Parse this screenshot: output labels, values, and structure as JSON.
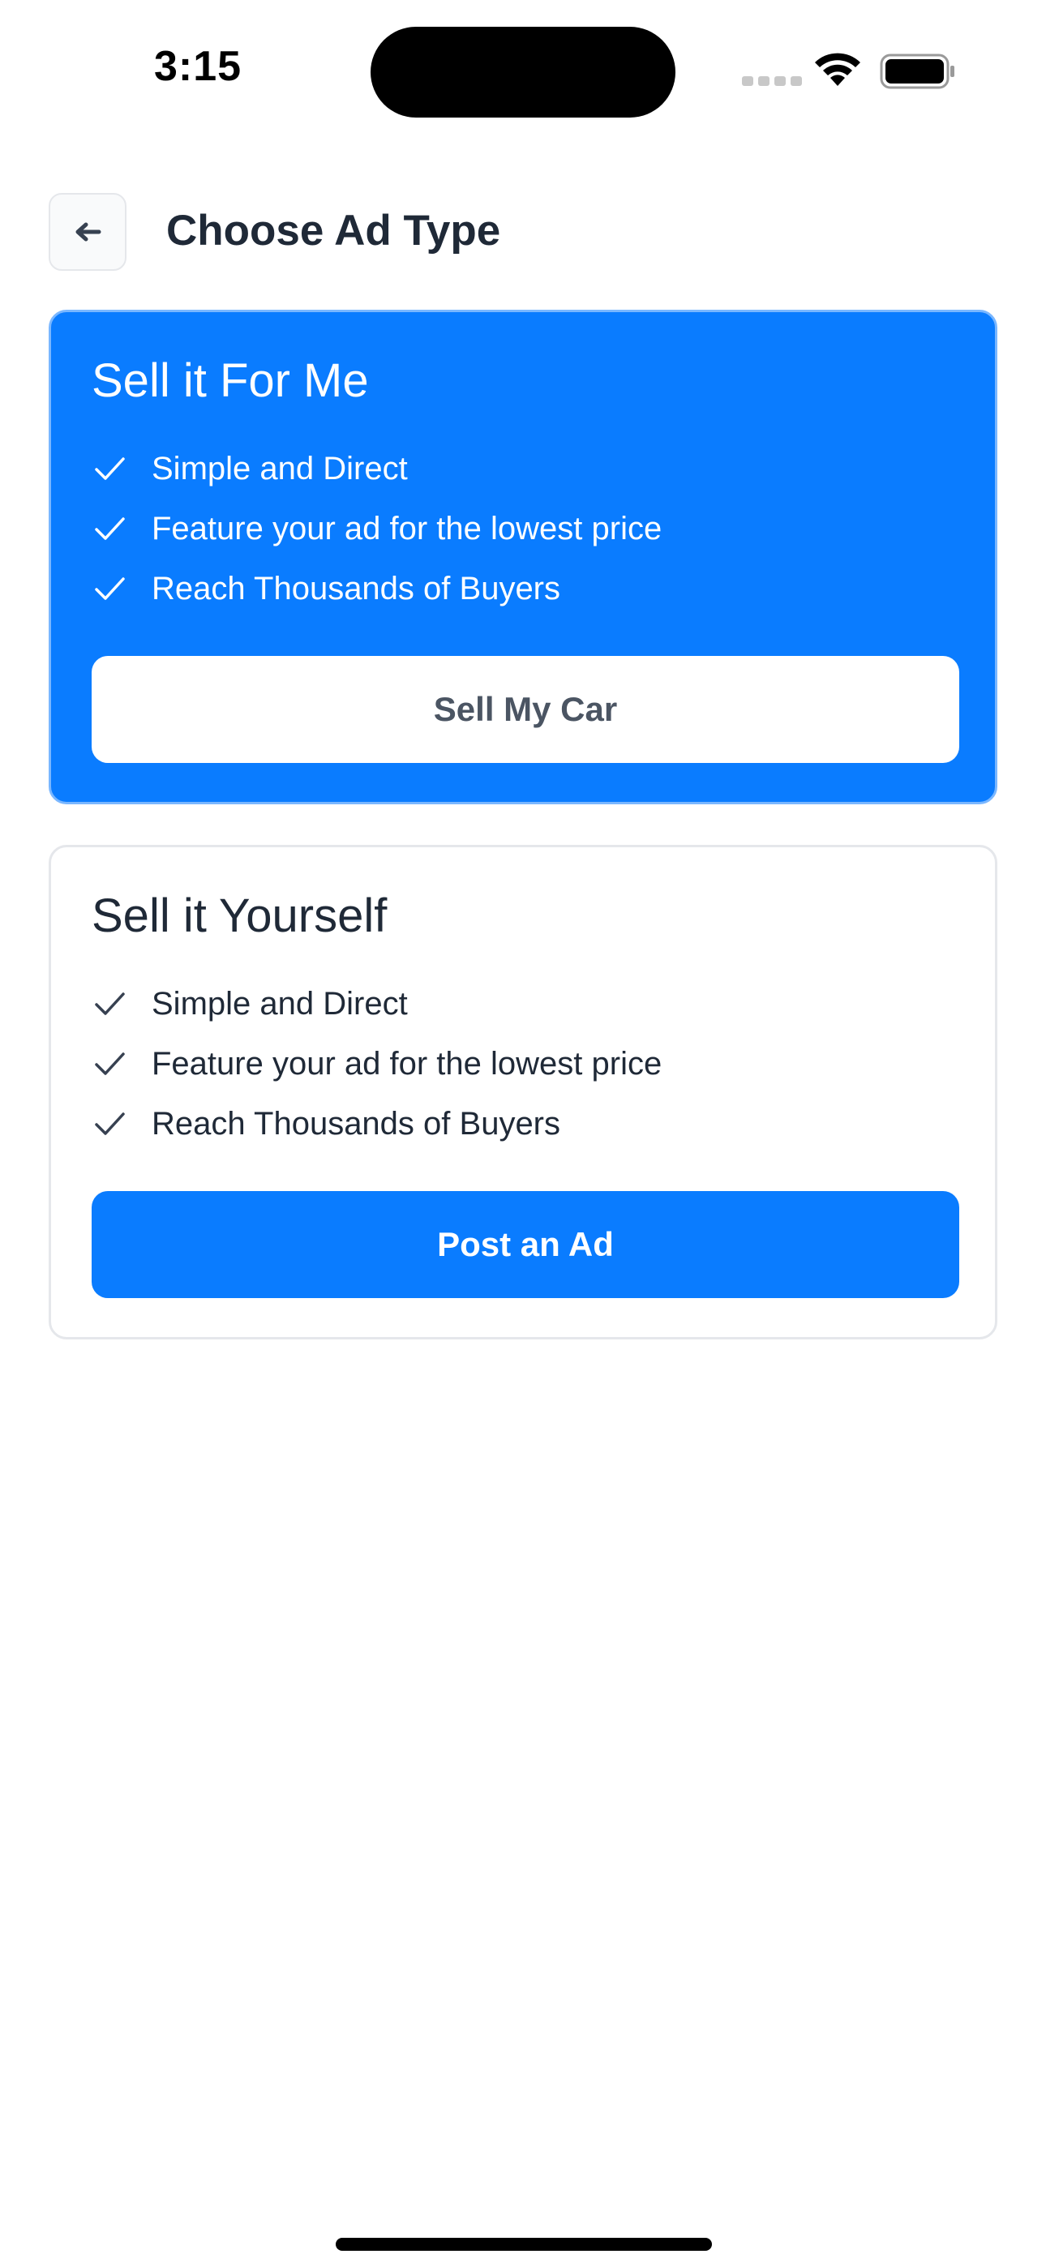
{
  "status_bar": {
    "time": "3:15",
    "icons": [
      "cellular-signal-icon",
      "wifi-icon",
      "battery-icon"
    ]
  },
  "header": {
    "back_icon": "arrow-left-icon",
    "title": "Choose Ad Type"
  },
  "cards": [
    {
      "title": "Sell it For Me",
      "features": [
        "Simple and Direct",
        "Feature your ad for the lowest price",
        "Reach Thousands of Buyers"
      ],
      "button_label": "Sell My Car",
      "style": "primary"
    },
    {
      "title": "Sell it Yourself",
      "features": [
        "Simple and Direct",
        "Feature your ad for the lowest price",
        "Reach Thousands of Buyers"
      ],
      "button_label": "Post an Ad",
      "style": "secondary"
    }
  ],
  "colors": {
    "accent": "#0a7cff",
    "title_text": "#1f2937",
    "button_text_muted": "#4b5563",
    "border": "#e5e7eb"
  }
}
